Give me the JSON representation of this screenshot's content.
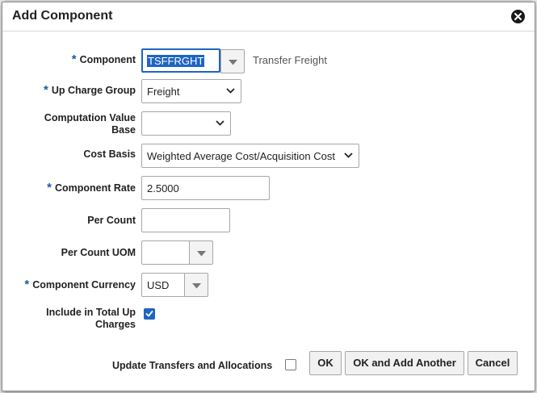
{
  "dialog": {
    "title": "Add Component"
  },
  "form": {
    "component": {
      "label": "Component",
      "required": "*",
      "value": "TSFFRGHT",
      "description": "Transfer Freight"
    },
    "up_charge_group": {
      "label": "Up Charge Group",
      "required": "*",
      "value": "Freight"
    },
    "computation_value_base": {
      "label_line1": "Computation Value",
      "label_line2": "Base",
      "value": ""
    },
    "cost_basis": {
      "label": "Cost Basis",
      "value": "Weighted Average Cost/Acquisition Cost"
    },
    "component_rate": {
      "label": "Component Rate",
      "required": "*",
      "value": "2.5000"
    },
    "per_count": {
      "label": "Per Count",
      "value": ""
    },
    "per_count_uom": {
      "label": "Per Count UOM",
      "value": ""
    },
    "component_currency": {
      "label": "Component Currency",
      "required": "*",
      "value": "USD"
    },
    "include_in_total": {
      "label_line1": "Include in Total Up",
      "label_line2": "Charges",
      "checked": true
    }
  },
  "footer": {
    "update_transfers_label": "Update Transfers and Allocations",
    "update_transfers_checked": false,
    "ok_label": "OK",
    "ok_add_another_label": "OK and Add Another",
    "cancel_label": "Cancel"
  },
  "colors": {
    "accent": "#1e65c3",
    "required": "#1b5aa6"
  }
}
